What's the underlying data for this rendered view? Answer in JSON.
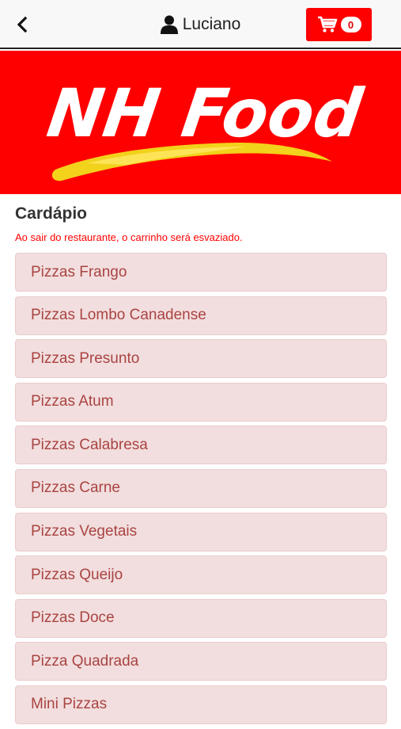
{
  "header": {
    "user_name": "Luciano",
    "cart_count": "0"
  },
  "banner": {
    "logo_text": "NH Food"
  },
  "main": {
    "section_title": "Cardápio",
    "warning": "Ao sair do restaurante, o carrinho será esvaziado.",
    "categories": [
      {
        "label": "Pizzas Frango"
      },
      {
        "label": "Pizzas Lombo Canadense"
      },
      {
        "label": "Pizzas Presunto"
      },
      {
        "label": "Pizzas Atum"
      },
      {
        "label": "Pizzas Calabresa"
      },
      {
        "label": "Pizzas Carne"
      },
      {
        "label": "Pizzas Vegetais"
      },
      {
        "label": "Pizzas Queijo"
      },
      {
        "label": "Pizzas Doce"
      },
      {
        "label": "Pizza Quadrada"
      },
      {
        "label": "Mini Pizzas"
      }
    ]
  },
  "colors": {
    "brand_red": "#ff0000",
    "logo_yellow": "#f2d21b",
    "item_bg": "#f2dede",
    "item_text": "#a94442"
  },
  "icons": {
    "back": "chevron-left-icon",
    "user": "user-icon",
    "cart": "shopping-cart-icon"
  }
}
